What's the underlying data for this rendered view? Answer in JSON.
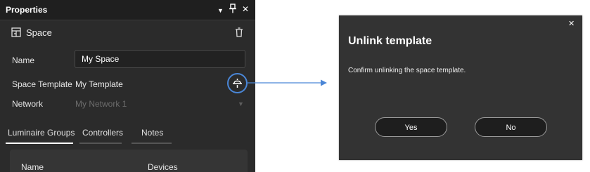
{
  "panel": {
    "title": "Properties",
    "titlebar_icons": {
      "dropdown": "▼",
      "pin": "pin-icon",
      "close": "✕"
    },
    "space": {
      "icon": "building-icon",
      "label": "Space",
      "delete_icon": "trash-icon"
    },
    "fields": {
      "name_label": "Name",
      "name_value": "My Space",
      "template_label": "Space Template",
      "template_value": "My Template",
      "network_label": "Network",
      "network_value": "My Network 1"
    },
    "tabs": [
      {
        "label": "Luminaire Groups",
        "active": true
      },
      {
        "label": "Controllers",
        "active": false
      },
      {
        "label": "Notes",
        "active": false
      }
    ],
    "table": {
      "columns": [
        "Name",
        "Devices"
      ]
    }
  },
  "dialog": {
    "title": "Unlink template",
    "message": "Confirm unlinking the space template.",
    "yes_label": "Yes",
    "no_label": "No",
    "close_icon": "✕"
  },
  "colors": {
    "panel_bg": "#2b2b2b",
    "titlebar_bg": "#1f1f1f",
    "dialog_bg": "#333333",
    "accent": "#4a86d6",
    "button_bg": "#1e1e1e"
  }
}
